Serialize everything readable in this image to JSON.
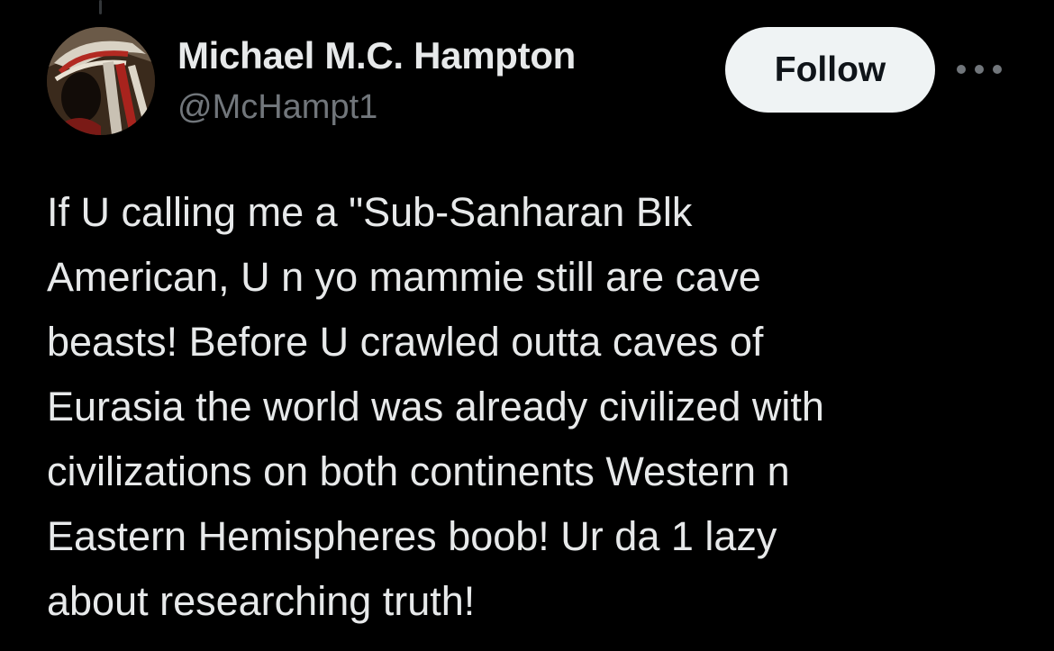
{
  "author": {
    "display_name": "Michael M.C. Hampton",
    "handle": "@McHampt1",
    "avatar_icon": "avatar-headdress-icon"
  },
  "actions": {
    "follow_label": "Follow",
    "more_icon": "more-options-icon"
  },
  "tweet": {
    "lines": [
      "If U calling me a \"Sub-Sanharan Blk",
      "American, U n yo mammie still are cave",
      "beasts! Before U crawled outta caves of",
      "Eurasia the world was already civilized with",
      "civilizations on both continents Western n",
      "Eastern Hemispheres boob! Ur da 1 lazy",
      "about researching truth!"
    ]
  },
  "colors": {
    "background": "#000000",
    "primary_text": "#e7e9ea",
    "secondary_text": "#71767b",
    "follow_button_bg": "#eff3f4",
    "follow_button_text": "#0f1419"
  }
}
